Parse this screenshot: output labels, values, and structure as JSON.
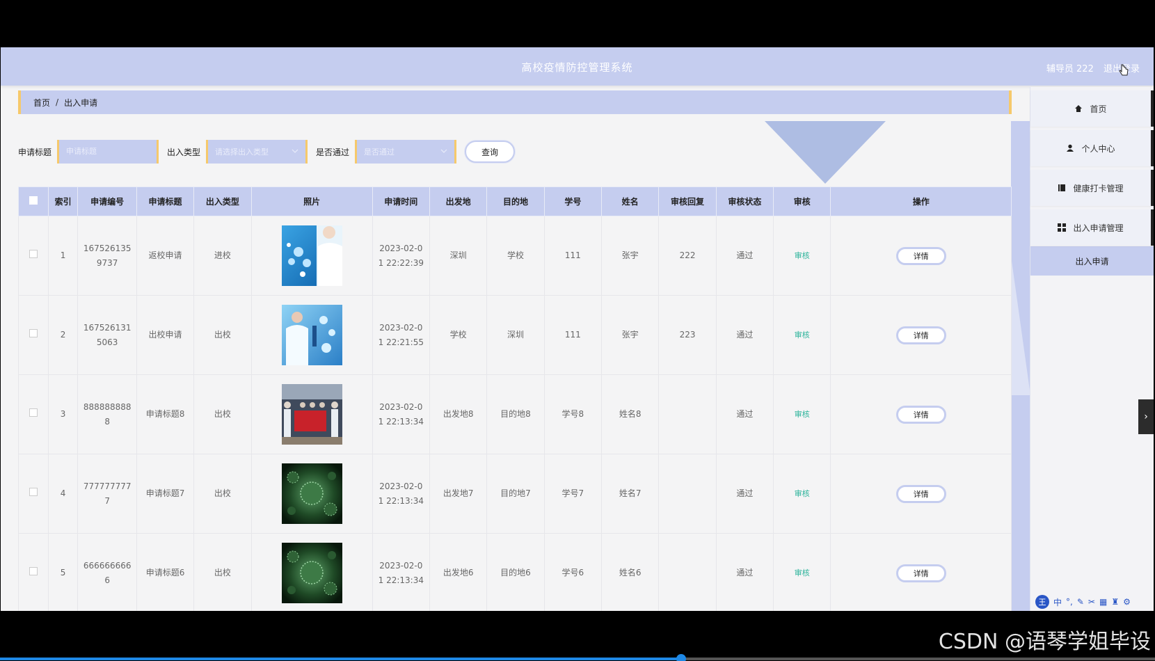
{
  "app": {
    "title": "高校疫情防控管理系统",
    "user_label": "辅导员 222",
    "logout_label": "退出登录"
  },
  "breadcrumb": {
    "home": "首页",
    "separator": "/",
    "current": "出入申请"
  },
  "sidebar": {
    "items": [
      {
        "label": "首页",
        "icon": "home-icon"
      },
      {
        "label": "个人中心",
        "icon": "user-icon"
      },
      {
        "label": "健康打卡管理",
        "icon": "book-icon"
      },
      {
        "label": "出入申请管理",
        "icon": "grid-icon"
      }
    ],
    "sub_item": "出入申请"
  },
  "search": {
    "title_label": "申请标题",
    "title_placeholder": "申请标题",
    "type_label": "出入类型",
    "type_placeholder": "请选择出入类型",
    "pass_label": "是否通过",
    "pass_placeholder": "是否通过",
    "query_button": "查询"
  },
  "table": {
    "columns": [
      "索引",
      "申请编号",
      "申请标题",
      "出入类型",
      "照片",
      "申请时间",
      "出发地",
      "目的地",
      "学号",
      "姓名",
      "审核回复",
      "审核状态",
      "审核",
      "操作"
    ],
    "audit_label": "审核",
    "detail_label": "详情",
    "rows": [
      {
        "index": "1",
        "number_a": "167526135",
        "number_b": "9737",
        "title": "返校申请",
        "type": "进校",
        "photo": "medical-photo-1",
        "time_a": "2023-02-0",
        "time_b": "1 22:22:39",
        "from": "深圳",
        "to": "学校",
        "student_no": "111",
        "name": "张宇",
        "reply": "222",
        "status": "通过"
      },
      {
        "index": "2",
        "number_a": "167526131",
        "number_b": "5063",
        "title": "出校申请",
        "type": "出校",
        "photo": "medical-photo-2",
        "time_a": "2023-02-0",
        "time_b": "1 22:21:55",
        "from": "学校",
        "to": "深圳",
        "student_no": "111",
        "name": "张宇",
        "reply": "223",
        "status": "通过"
      },
      {
        "index": "3",
        "number_a": "888888888",
        "number_b": "8",
        "title": "申请标题8",
        "type": "出校",
        "photo": "group-photo",
        "time_a": "2023-02-0",
        "time_b": "1 22:13:34",
        "from": "出发地8",
        "to": "目的地8",
        "student_no": "学号8",
        "name": "姓名8",
        "reply": "",
        "status": "通过"
      },
      {
        "index": "4",
        "number_a": "777777777",
        "number_b": "7",
        "title": "申请标题7",
        "type": "出校",
        "photo": "virus-photo",
        "time_a": "2023-02-0",
        "time_b": "1 22:13:34",
        "from": "出发地7",
        "to": "目的地7",
        "student_no": "学号7",
        "name": "姓名7",
        "reply": "",
        "status": "通过"
      },
      {
        "index": "5",
        "number_a": "666666666",
        "number_b": "6",
        "title": "申请标题6",
        "type": "出校",
        "photo": "virus-photo",
        "time_a": "2023-02-0",
        "time_b": "1 22:13:34",
        "from": "出发地6",
        "to": "目的地6",
        "student_no": "学号6",
        "name": "姓名6",
        "reply": "",
        "status": "通过"
      }
    ]
  },
  "overlay": {
    "watermark": "CSDN @语琴学姐毕设",
    "ime_logo": "王",
    "ime_mode": "中",
    "video_progress": 0.59
  },
  "colors": {
    "header": "#c5cdef",
    "accent": "#f6c96b",
    "audit": "#2bb39a",
    "progress": "#1e88e5"
  }
}
